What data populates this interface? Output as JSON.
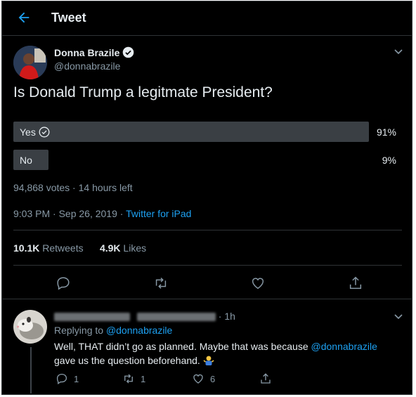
{
  "header": {
    "title": "Tweet"
  },
  "tweet": {
    "author_name": "Donna Brazile",
    "author_handle": "@donnabrazile",
    "text": "Is Donald Trump a legitmate President?",
    "poll": {
      "options": [
        {
          "label": "Yes",
          "percent": "91%",
          "share": 0.91
        },
        {
          "label": "No",
          "percent": "9%",
          "share": 0.09
        }
      ],
      "footer": "94,868 votes · 14 hours left"
    },
    "timestamp": "9:03 PM · Sep 26, 2019 · ",
    "source": "Twitter for iPad",
    "retweets_count": "10.1K",
    "retweets_label": "Retweets",
    "likes_count": "4.9K",
    "likes_label": "Likes"
  },
  "reply": {
    "time": "1h",
    "replying_prefix": "Replying to ",
    "replying_handle": "@donnabrazile",
    "text_part1": "Well, THAT didn’t go as planned. Maybe that was because ",
    "text_mention": "@donnabrazile",
    "text_part2": " gave us the question beforehand.",
    "reply_count": "1",
    "retweet_count": "1",
    "like_count": "6"
  },
  "colors": {
    "accent": "#1da1f2",
    "background": "#000000",
    "muted": "#8899a6",
    "bar": "#3a3f44"
  }
}
